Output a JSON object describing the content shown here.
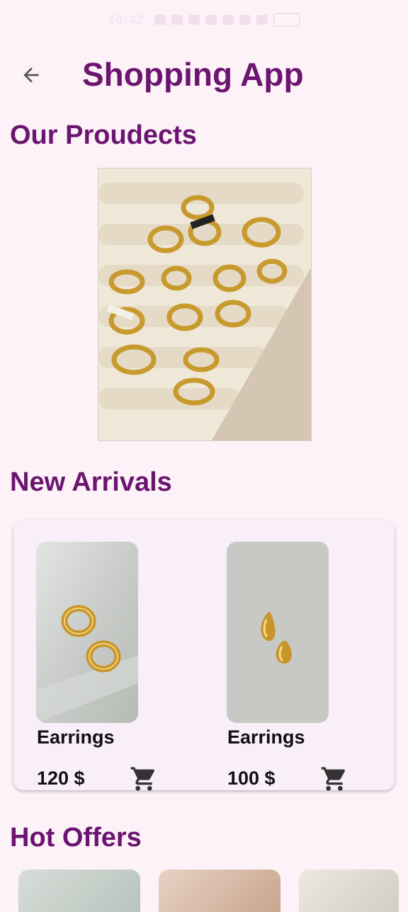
{
  "status_bar": {
    "time": "10:42",
    "battery": ""
  },
  "header": {
    "title": "Shopping App",
    "back_icon": "arrow-left-icon"
  },
  "sections": {
    "products_title": "Our Proudects",
    "new_arrivals_title": "New Arrivals",
    "hot_offers_title": "Hot Offers"
  },
  "new_arrivals": [
    {
      "name": "Earrings",
      "price": "120 $",
      "image": "gold-hoop-earrings-photo",
      "cart_icon": "cart-icon"
    },
    {
      "name": "Earrings",
      "price": "100 $",
      "image": "gold-teardrop-earrings-photo",
      "cart_icon": "cart-icon"
    }
  ],
  "colors": {
    "background": "#fdf2f8",
    "title": "#6b1570",
    "card": "#f8eff8",
    "text": "#111111"
  }
}
